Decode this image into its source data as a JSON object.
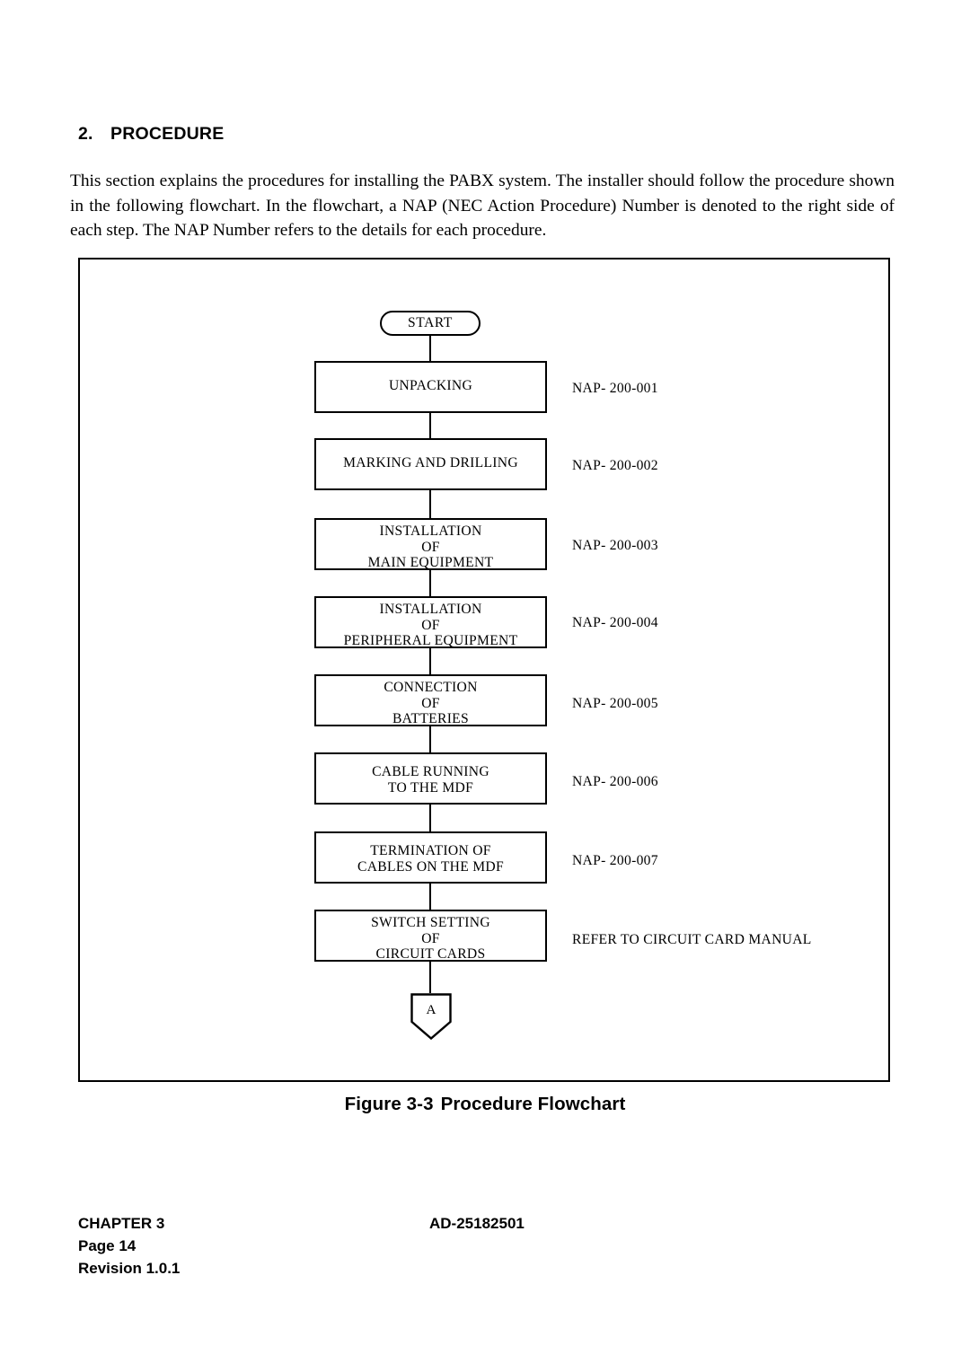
{
  "section": {
    "number": "2.",
    "title": "PROCEDURE",
    "paragraph": "This section explains the procedures for installing the PABX system. The installer should follow the procedure shown in the following flowchart. In the flowchart, a NAP (NEC Action Procedure) Number is denoted to the right side of each step. The NAP Number refers to the details for each procedure."
  },
  "flowchart": {
    "start": {
      "label": "START"
    },
    "steps": [
      {
        "label_line1": "UNPACKING",
        "label_line2": "",
        "label_line3": "",
        "note": "NAP- 200-001"
      },
      {
        "label_line1": "MARKING AND DRILLING",
        "label_line2": "",
        "label_line3": "",
        "note": "NAP- 200-002"
      },
      {
        "label_line1": "INSTALLATION",
        "label_line2": "OF",
        "label_line3": "MAIN EQUIPMENT",
        "note": "NAP- 200-003"
      },
      {
        "label_line1": "INSTALLATION",
        "label_line2": "OF",
        "label_line3": "PERIPHERAL EQUIPMENT",
        "note": "NAP- 200-004"
      },
      {
        "label_line1": "CONNECTION",
        "label_line2": "OF",
        "label_line3": "BATTERIES",
        "note": "NAP- 200-005"
      },
      {
        "label_line1": "CABLE RUNNING",
        "label_line2": "TO THE MDF",
        "label_line3": "",
        "note": "NAP- 200-006"
      },
      {
        "label_line1": "TERMINATION OF",
        "label_line2": "CABLES ON THE MDF",
        "label_line3": "",
        "note": "NAP- 200-007"
      },
      {
        "label_line1": "SWITCH SETTING",
        "label_line2": "OF",
        "label_line3": "CIRCUIT CARDS",
        "note": "REFER TO CIRCUIT CARD MANUAL"
      }
    ],
    "offpage_connector": {
      "label": "A"
    }
  },
  "figure_caption": {
    "number": "Figure 3-3",
    "title": "Procedure Flowchart"
  },
  "footer": {
    "chapter": "CHAPTER 3",
    "page": "Page 14",
    "revision": "Revision 1.0.1",
    "document_number": "AD-25182501"
  }
}
